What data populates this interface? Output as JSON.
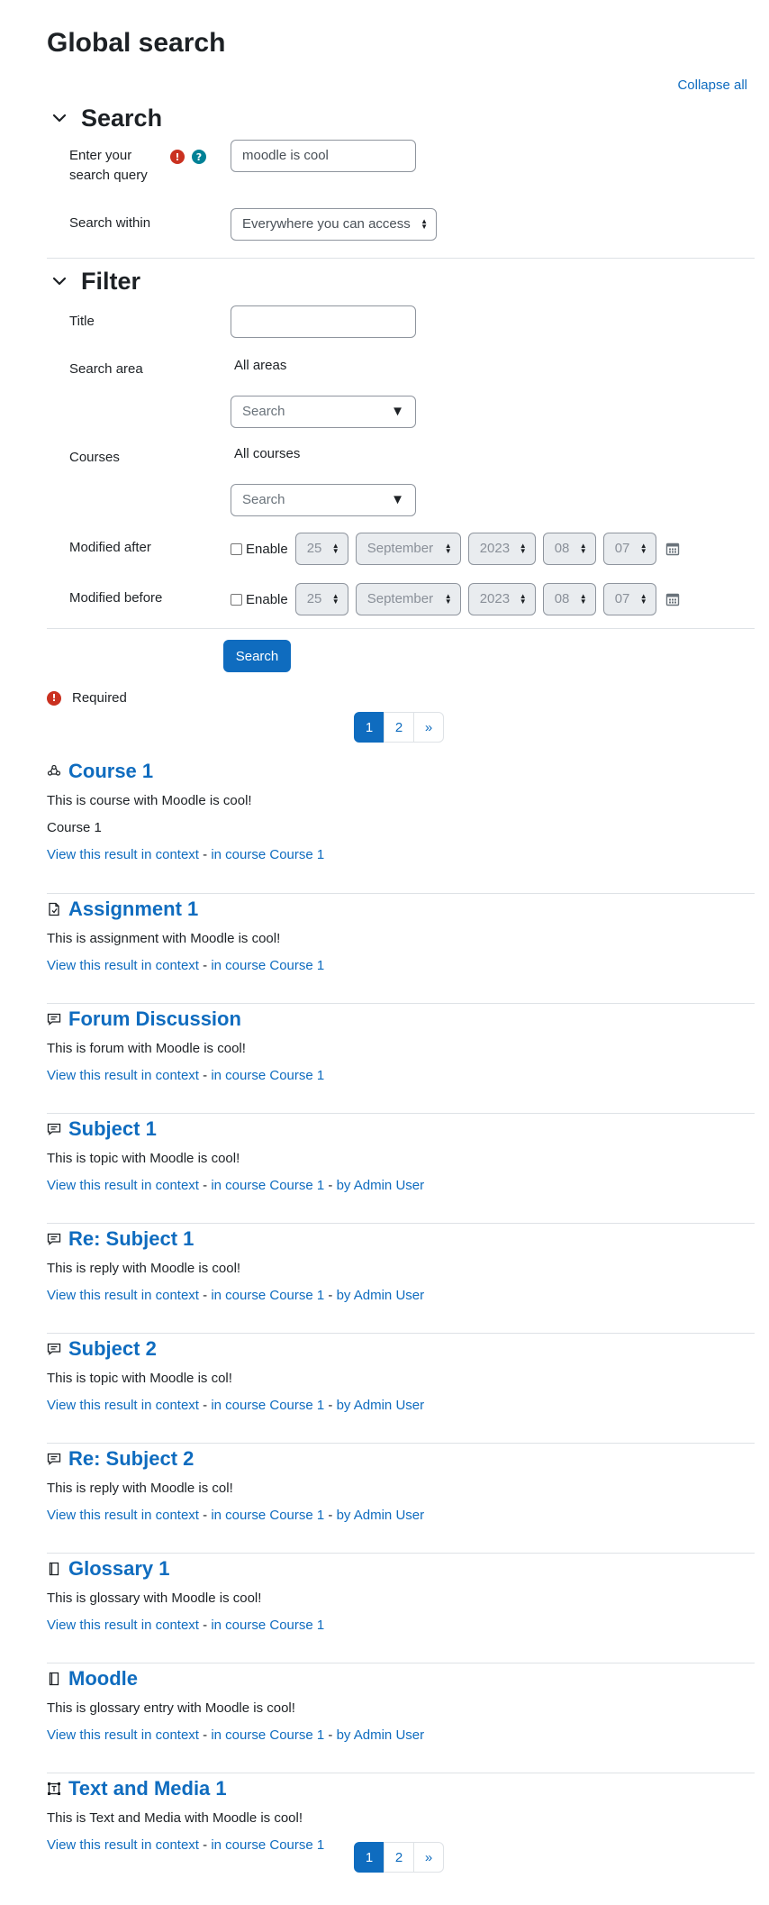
{
  "page": {
    "title": "Global search",
    "collapse_all": "Collapse all"
  },
  "search_section": {
    "heading": "Search",
    "query_label": "Enter your search query",
    "query_value": "moodle is cool",
    "within_label": "Search within",
    "within_value": "Everywhere you can access"
  },
  "filter_section": {
    "heading": "Filter",
    "title_label": "Title",
    "title_value": "",
    "area_label": "Search area",
    "area_selected": "All areas",
    "area_placeholder": "Search",
    "courses_label": "Courses",
    "courses_selected": "All courses",
    "courses_placeholder": "Search",
    "modified_after_label": "Modified after",
    "modified_before_label": "Modified before",
    "enable_label": "Enable",
    "date": {
      "day": "25",
      "month": "September",
      "year": "2023",
      "hour": "08",
      "minute": "07"
    }
  },
  "actions": {
    "search_button": "Search",
    "required_note": "Required"
  },
  "pagination": {
    "pages": [
      "1",
      "2"
    ],
    "next": "»",
    "current": "1"
  },
  "link_texts": {
    "context": "View this result in context",
    "separator": " - "
  },
  "results": [
    {
      "title": "Course 1",
      "icon": "course-icon",
      "lines": [
        "This is course with Moodle is cool!",
        "Course 1"
      ],
      "course": "in course Course 1",
      "author": ""
    },
    {
      "title": "Assignment 1",
      "icon": "assignment-icon",
      "lines": [
        "This is assignment with Moodle is cool!"
      ],
      "course": "in course Course 1",
      "author": ""
    },
    {
      "title": "Forum Discussion",
      "icon": "forum-icon",
      "lines": [
        "This is forum with Moodle is cool!"
      ],
      "course": "in course Course 1",
      "author": ""
    },
    {
      "title": "Subject 1",
      "icon": "forum-icon",
      "lines": [
        "This is topic with Moodle is cool!"
      ],
      "course": "in course Course 1",
      "author": "by Admin User"
    },
    {
      "title": "Re: Subject 1",
      "icon": "forum-icon",
      "lines": [
        "This is reply with Moodle is cool!"
      ],
      "course": "in course Course 1",
      "author": "by Admin User"
    },
    {
      "title": "Subject 2",
      "icon": "forum-icon",
      "lines": [
        "This is topic with Moodle is col!"
      ],
      "course": "in course Course 1",
      "author": "by Admin User"
    },
    {
      "title": "Re: Subject 2",
      "icon": "forum-icon",
      "lines": [
        "This is reply with Moodle is col!"
      ],
      "course": "in course Course 1",
      "author": "by Admin User"
    },
    {
      "title": "Glossary 1",
      "icon": "glossary-icon",
      "lines": [
        "This is glossary with Moodle is cool!"
      ],
      "course": "in course Course 1",
      "author": ""
    },
    {
      "title": "Moodle",
      "icon": "glossary-icon",
      "lines": [
        "This is glossary entry with Moodle is cool!"
      ],
      "course": "in course Course 1",
      "author": "by Admin User"
    },
    {
      "title": "Text and Media 1",
      "icon": "text-media-icon",
      "lines": [
        "This is Text and Media with Moodle is cool!"
      ],
      "course": "in course Course 1",
      "author": ""
    }
  ],
  "colors": {
    "link": "#0f6cbf",
    "primary": "#0f6cbf",
    "required": "#ca3120",
    "help": "#008196",
    "divider": "#dee2e6"
  }
}
